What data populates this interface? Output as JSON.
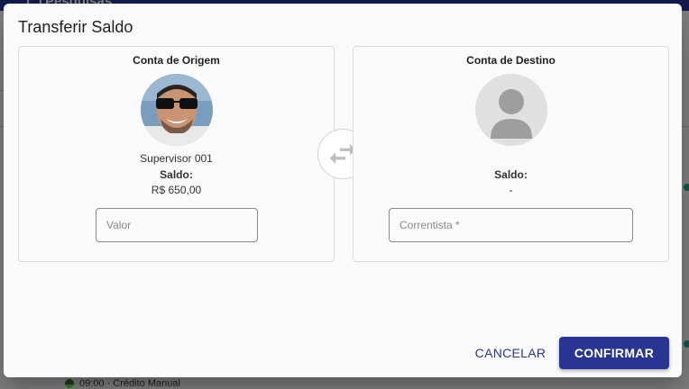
{
  "background": {
    "app_title": "Pesquisas",
    "list_item_text": "09:00 · Crédito Manual"
  },
  "dialog": {
    "title": "Transferir Saldo",
    "origin": {
      "heading": "Conta de Origem",
      "name": "Supervisor 001",
      "balance_label": "Saldo:",
      "balance_value": "R$ 650,00",
      "input_placeholder": "Valor"
    },
    "destination": {
      "heading": "Conta de Destino",
      "balance_label": "Saldo:",
      "balance_value": "-",
      "input_placeholder": "Correntista *"
    },
    "swap_icon": "swap-horizontal-icon",
    "actions": {
      "cancel_label": "CANCELAR",
      "confirm_label": "CONFIRMAR"
    }
  },
  "colors": {
    "primary": "#283593",
    "scrim": "rgba(0,0,0,0.5)",
    "card_border": "#dcdcdc"
  }
}
